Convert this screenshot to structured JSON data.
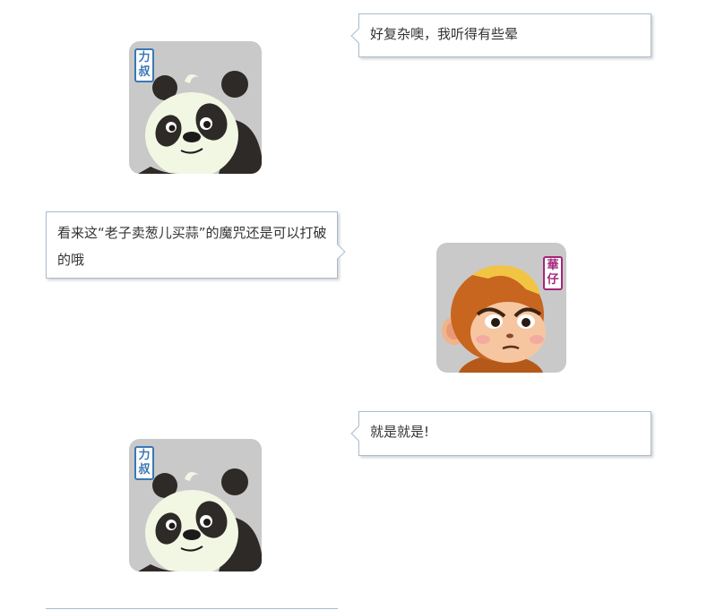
{
  "conversation": {
    "messages": [
      {
        "speaker": "panda",
        "text": "好复杂噢，我听得有些晕"
      },
      {
        "speaker": "monkey",
        "text": "看来这“老子卖葱儿买蒜”的魔咒还是可以打破的哦"
      },
      {
        "speaker": "panda",
        "text": "就是就是!"
      }
    ]
  },
  "avatars": {
    "panda": {
      "badge_chars": [
        "力",
        "叔"
      ],
      "badge_color": "#3a78b5",
      "bg_color": "#c9c9c9"
    },
    "monkey": {
      "badge_chars": [
        "華",
        "仔"
      ],
      "badge_color": "#a3267a",
      "bg_color": "#c9c9c9"
    }
  },
  "colors": {
    "bubble_border": "#a9bccc",
    "text": "#333333"
  }
}
